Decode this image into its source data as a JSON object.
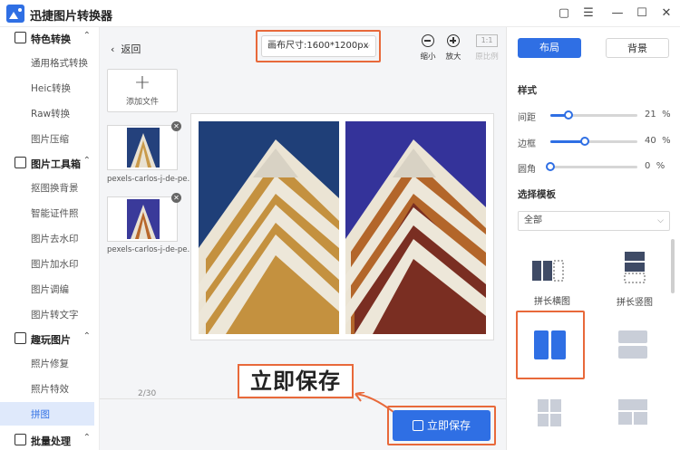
{
  "app": {
    "title": "迅捷图片转换器"
  },
  "window_controls": {
    "minimize": "—",
    "maximize": "☐",
    "close": "✕",
    "menu": "☰",
    "pin": "▢"
  },
  "sidebar": {
    "groups": [
      {
        "label": "特色转换",
        "items": [
          "通用格式转换",
          "Heic转换",
          "Raw转换",
          "图片压缩"
        ]
      },
      {
        "label": "图片工具箱",
        "items": [
          "抠图换背景",
          "智能证件照",
          "图片去水印",
          "图片加水印",
          "图片调编",
          "图片转文字"
        ]
      },
      {
        "label": "趣玩图片",
        "items": [
          "照片修复",
          "照片特效",
          "拼图"
        ]
      },
      {
        "label": "批量处理",
        "items": []
      }
    ],
    "active_item": "拼图"
  },
  "toolbar": {
    "back_label": "返回",
    "canvas_size": "画布尺寸:1600*1200px",
    "zoom_out_label": "缩小",
    "zoom_in_label": "放大",
    "ratio_box": "1:1",
    "original_ratio_label": "原比例"
  },
  "files": {
    "add_label": "添加文件",
    "items": [
      {
        "name": "pexels-carlos-j-de-pe..."
      },
      {
        "name": "pexels-carlos-j-de-pe..."
      }
    ],
    "page_indicator": "2/30"
  },
  "annotation": {
    "callout_text": "立即保存"
  },
  "save_button": {
    "label": "立即保存"
  },
  "panel": {
    "tabs": {
      "layout": "布局",
      "background": "背景"
    },
    "style_title": "样式",
    "sliders": [
      {
        "label": "间距",
        "value": 21,
        "unit": "%"
      },
      {
        "label": "边框",
        "value": 40,
        "unit": "%"
      },
      {
        "label": "圆角",
        "value": 0,
        "unit": "%"
      }
    ],
    "template_title": "选择模板",
    "template_filter": "全部",
    "templates": [
      {
        "label": "拼长横图"
      },
      {
        "label": "拼长竖图"
      }
    ]
  },
  "colors": {
    "accent": "#2f6fe4",
    "highlight": "#e8693a"
  }
}
